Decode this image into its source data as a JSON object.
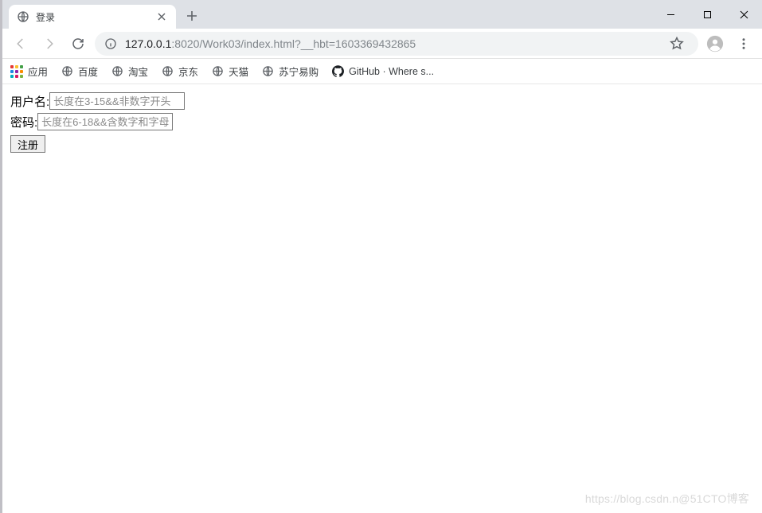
{
  "window": {
    "tab": {
      "title": "登录"
    },
    "url_host": "127.0.0.1",
    "url_port": ":8020",
    "url_path": "/Work03/index.html?__hbt=1603369432865"
  },
  "bookmarks": {
    "apps": "应用",
    "items": [
      {
        "label": "百度"
      },
      {
        "label": "淘宝"
      },
      {
        "label": "京东"
      },
      {
        "label": "天猫"
      },
      {
        "label": "苏宁易购"
      },
      {
        "label": "GitHub · Where s..."
      }
    ]
  },
  "form": {
    "username_label": "用户名:",
    "username_placeholder": "长度在3-15&&非数字开头",
    "password_label": "密码:",
    "password_placeholder": "长度在6-18&&含数字和字母",
    "submit_label": "注册"
  },
  "watermark": "https://blog.csdn.n@51CTO博客"
}
